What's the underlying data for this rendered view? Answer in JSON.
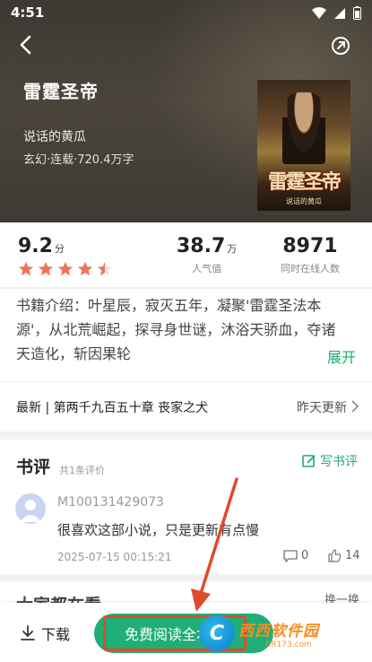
{
  "status_bar": {
    "time": "4:51"
  },
  "book": {
    "title": "雷霆圣帝",
    "author": "说话的黄瓜",
    "meta": "玄幻·连载·720.4万字",
    "cover_title": "雷霆圣帝",
    "cover_author": "说话的黄瓜"
  },
  "stats": {
    "score": "9.2",
    "score_unit": "分",
    "rating_stars": 4.5,
    "popularity_value": "38.7",
    "popularity_unit": "万",
    "popularity_label": "人气值",
    "online_value": "8971",
    "online_label": "同时在线人数"
  },
  "intro": {
    "text": "书籍介绍：叶星辰，寂灭五年，凝聚'雷霆圣法本源'，从北荒崛起，探寻身世谜，沐浴天骄血，夺诸天造化，斩因果轮",
    "expand_label": "展开"
  },
  "latest": {
    "chapter": "最新 | 第两千九百五十章 丧家之犬",
    "updated": "昨天更新"
  },
  "reviews": {
    "title": "书评",
    "count": "共1条评价",
    "write_label": "写书评",
    "items": [
      {
        "user": "M100131429073",
        "text": "很喜欢这部小说，只是更新有点慢",
        "date": "2025-07-15 00:15:21",
        "comments": "0",
        "likes": "14"
      }
    ]
  },
  "popular": {
    "title": "大家都在看",
    "refresh_label": "换一换"
  },
  "bottom": {
    "download_label": "下载",
    "read_label": "免费阅读全本"
  },
  "watermark": {
    "logo": "C",
    "main": "西西软件园",
    "sub": "CR173.com"
  },
  "colors": {
    "accent": "#1faa70",
    "star": "#f0735a",
    "highlight": "#e04a2a"
  }
}
